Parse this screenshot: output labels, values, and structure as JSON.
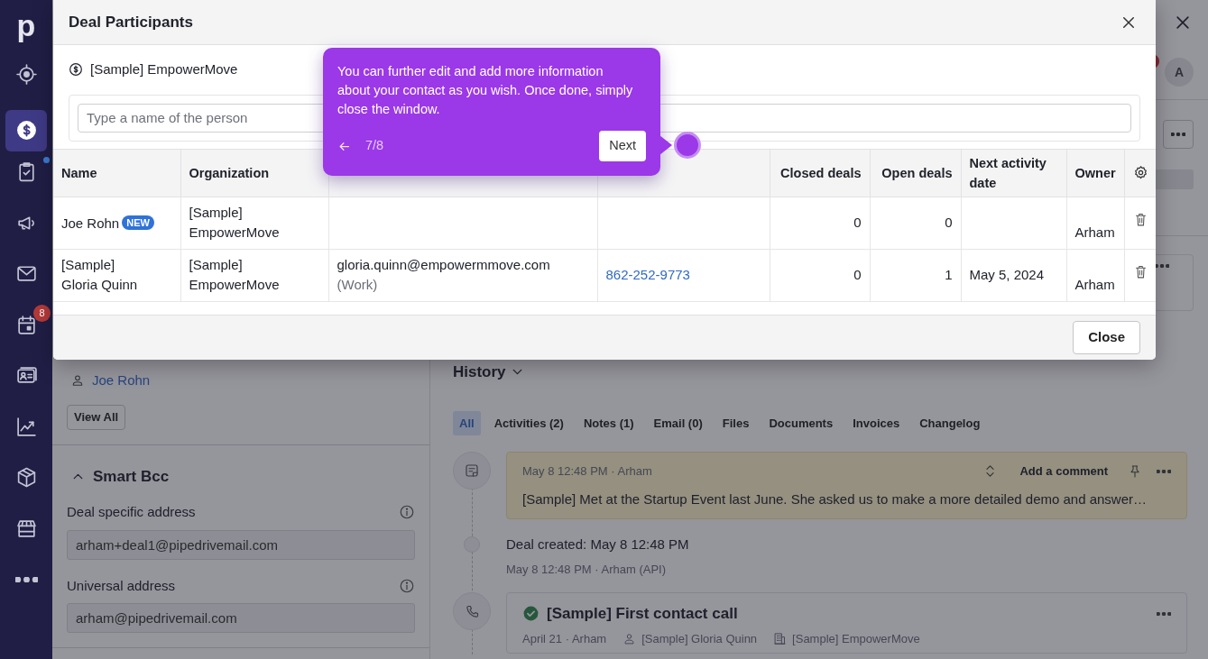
{
  "sidebar": {
    "logo": "p",
    "items": [
      {
        "selected": false,
        "has_update": false
      },
      {
        "selected": true,
        "has_update": false
      },
      {
        "selected": false,
        "has_update": true
      },
      {
        "selected": false,
        "has_update": false
      },
      {
        "selected": false,
        "has_update": false
      },
      {
        "selected": false,
        "has_update": false,
        "badge": "8"
      },
      {
        "selected": false,
        "has_update": false
      },
      {
        "selected": false,
        "has_update": false
      },
      {
        "selected": false,
        "has_update": false
      },
      {
        "selected": false,
        "has_update": false
      },
      {
        "selected": false,
        "has_update": false
      }
    ]
  },
  "avatar": {
    "initial": "A"
  },
  "participants": {
    "links": [
      "Joe Rohn"
    ],
    "view_all": "View All"
  },
  "smart_bcc": {
    "title": "Smart Bcc",
    "expanded": true,
    "fields": [
      {
        "label": "Deal specific address",
        "value": "arham+deal1@pipedrivemail.com"
      },
      {
        "label": "Universal address",
        "value": "arham@pipedrivemail.com"
      }
    ]
  },
  "history": {
    "title": "History",
    "tabs": [
      {
        "label": "All",
        "selected": true
      },
      {
        "label": "Activities (2)",
        "selected": false
      },
      {
        "label": "Notes (1)",
        "selected": false
      },
      {
        "label": "Email (0)",
        "selected": false
      },
      {
        "label": "Files",
        "selected": false
      },
      {
        "label": "Documents",
        "selected": false
      },
      {
        "label": "Invoices",
        "selected": false
      },
      {
        "label": "Changelog",
        "selected": false
      }
    ],
    "timeline": [
      {
        "kind": "note",
        "meta": "May 8 12:48 PM · Arham",
        "action": "Add a comment",
        "text": "[Sample] Met at the Startup Event last June. She asked us to make a more detailed demo and answer…"
      },
      {
        "kind": "event",
        "text": "Deal created: May 8 12:48 PM",
        "meta": "May 8 12:48 PM · Arham (API)"
      },
      {
        "kind": "activity",
        "done": true,
        "title": "[Sample] First contact call",
        "meta": "April 21 · Arham",
        "person": "[Sample] Gloria Quinn",
        "organization": "[Sample] EmpowerMove"
      }
    ]
  },
  "modal": {
    "title": "Deal Participants",
    "deal": "[Sample] EmpowerMove",
    "search": {
      "placeholder": "Type a name of the person"
    },
    "table": {
      "columns": {
        "name": "Name",
        "organization": "Organization",
        "closed_deals": "Closed deals",
        "open_deals": "Open deals",
        "next_activity_date": "Next activity date",
        "owner": "Owner"
      },
      "rows": [
        {
          "name": "Joe Rohn",
          "badge": "NEW",
          "organization": "[Sample] EmpowerMove",
          "closed_deals": "0",
          "open_deals": "0",
          "owner": "Arham"
        },
        {
          "name": "[Sample] Gloria Quinn",
          "organization": "[Sample] EmpowerMove",
          "column_3": "gloria.quinn@empowermmove.com",
          "column_3_note": "(Work)",
          "column_4": "862-252-9773",
          "closed_deals": "0",
          "open_deals": "1",
          "next_activity_date": "May 5, 2024",
          "owner": "Arham"
        }
      ]
    },
    "close_button": "Close"
  },
  "tour": {
    "text": "You can further edit and add more information about your contact as you wish. Once done, simply close the window.",
    "step": "7/8",
    "next": "Next"
  }
}
